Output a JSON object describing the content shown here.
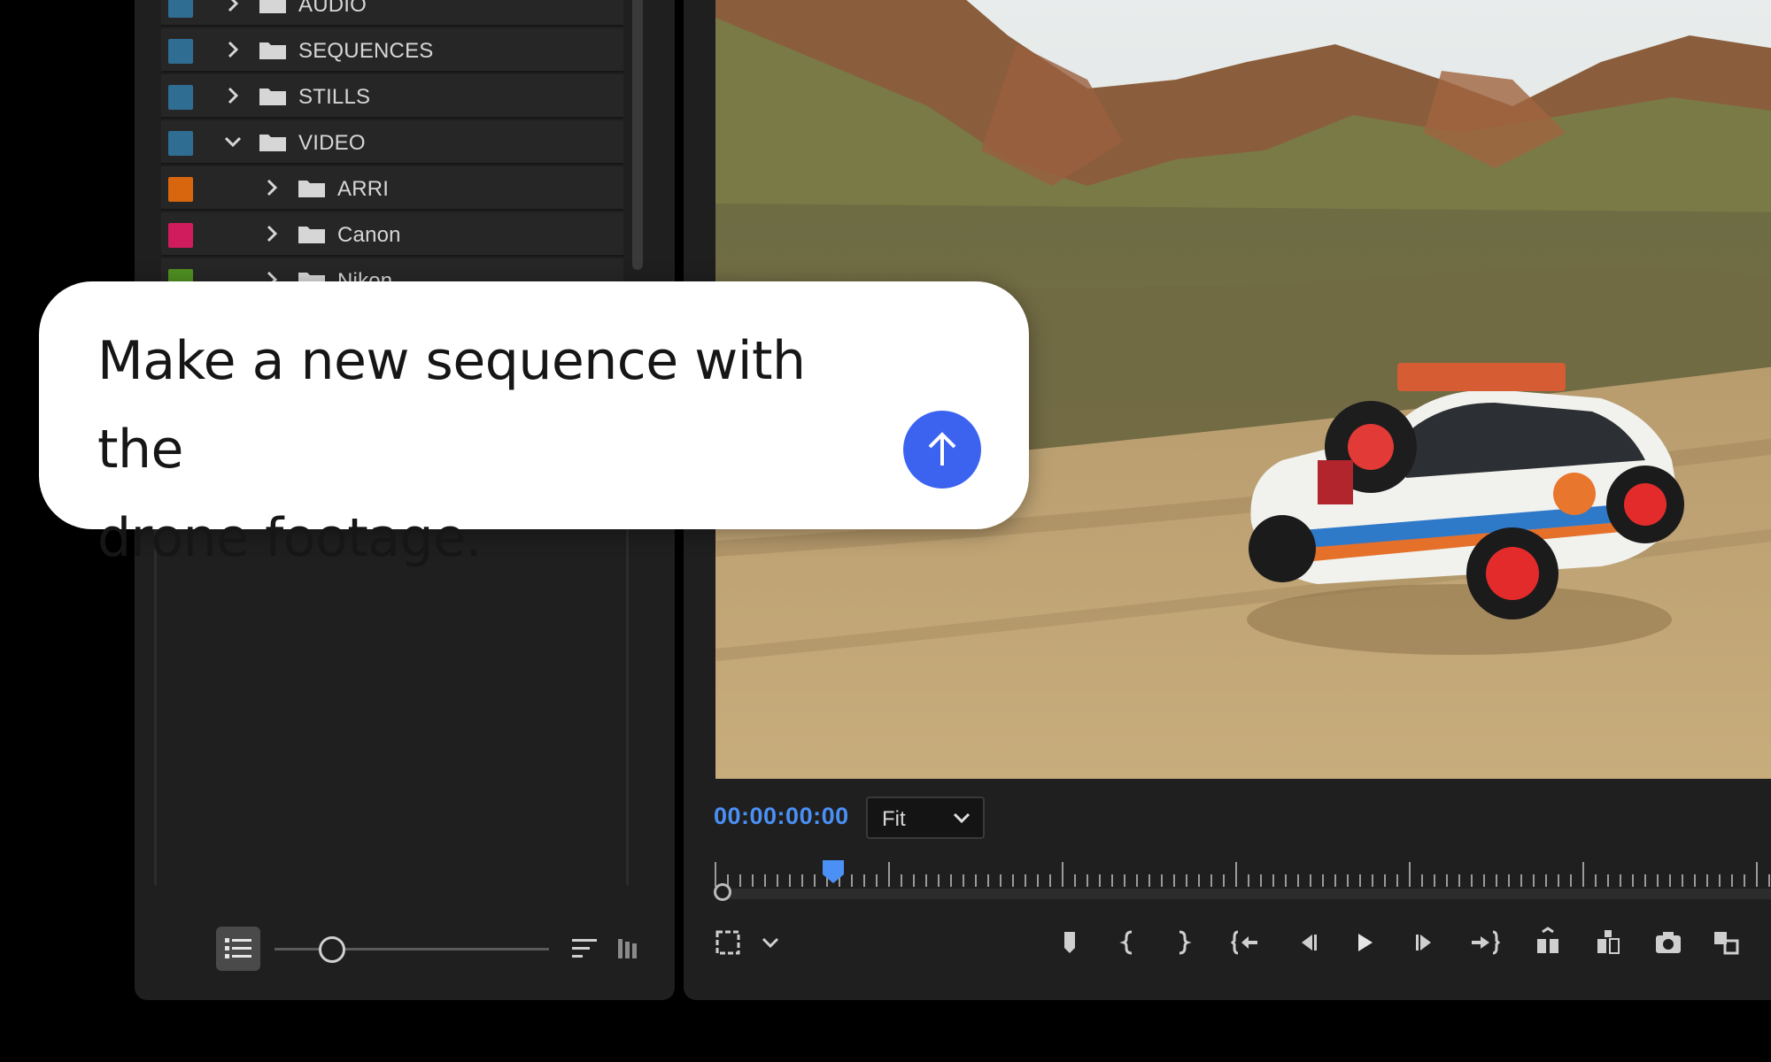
{
  "project_panel": {
    "bins": [
      {
        "label": "AUDIO",
        "color": "#2f6d93",
        "expanded": false,
        "indent": 0
      },
      {
        "label": "SEQUENCES",
        "color": "#2f6d93",
        "expanded": false,
        "indent": 0
      },
      {
        "label": "STILLS",
        "color": "#2f6d93",
        "expanded": false,
        "indent": 0
      },
      {
        "label": "VIDEO",
        "color": "#2f6d93",
        "expanded": true,
        "indent": 0
      },
      {
        "label": "ARRI",
        "color": "#d8660f",
        "expanded": false,
        "indent": 1
      },
      {
        "label": "Canon",
        "color": "#d01c5c",
        "expanded": false,
        "indent": 1
      },
      {
        "label": "Nikon",
        "color": "#4f8f22",
        "expanded": false,
        "indent": 1
      }
    ],
    "footer": {
      "list_view_icon": "list-view-icon",
      "zoom_level": 0.2,
      "sort_icon": "sort-icon",
      "freeform_icon": "freeform-view-icon"
    }
  },
  "program_monitor": {
    "timecode": "00:00:00:00",
    "fit_select": "Fit",
    "playhead_position": 0.11,
    "transport_icons": [
      "add-marker-icon",
      "mark-in-icon",
      "mark-out-icon",
      "go-to-in-icon",
      "step-back-icon",
      "play-icon",
      "step-forward-icon",
      "go-to-out-icon",
      "lift-icon",
      "extract-icon",
      "export-frame-icon",
      "compare-view-icon"
    ]
  },
  "prompt": {
    "text_line1": "Make a new sequence with the",
    "text_line2": "drone footage.",
    "send_icon": "arrow-up-icon",
    "accent": "#3b63f0"
  }
}
